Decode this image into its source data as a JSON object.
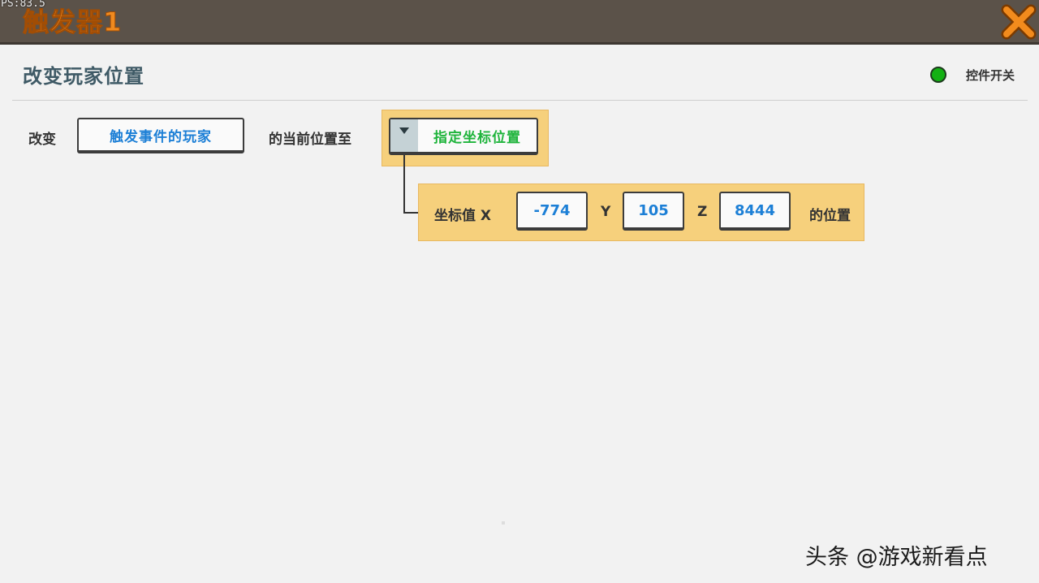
{
  "header": {
    "fps_text": "PS:83.5",
    "title": "触发器1"
  },
  "section": {
    "title": "改变玩家位置",
    "switch_label": "控件开关",
    "switch_color": "#14b114"
  },
  "statement": {
    "prefix": "改变",
    "target_button": "触发事件的玩家",
    "middle": "的当前位置至",
    "dropdown_selected": "指定坐标位置"
  },
  "coords": {
    "label_x": "坐标值 X",
    "x_value": "-774",
    "label_y": "Y",
    "y_value": "105",
    "label_z": "Z",
    "z_value": "8444",
    "suffix": "的位置"
  },
  "watermark": "头条 @游戏新看点",
  "colors": {
    "accent_orange": "#f08a1f",
    "highlight_yellow": "#f6d07c",
    "value_blue": "#1c7fd6",
    "option_green": "#1fb43c"
  },
  "icons": {
    "close": "close-icon",
    "dropdown": "triangle-down-icon"
  }
}
